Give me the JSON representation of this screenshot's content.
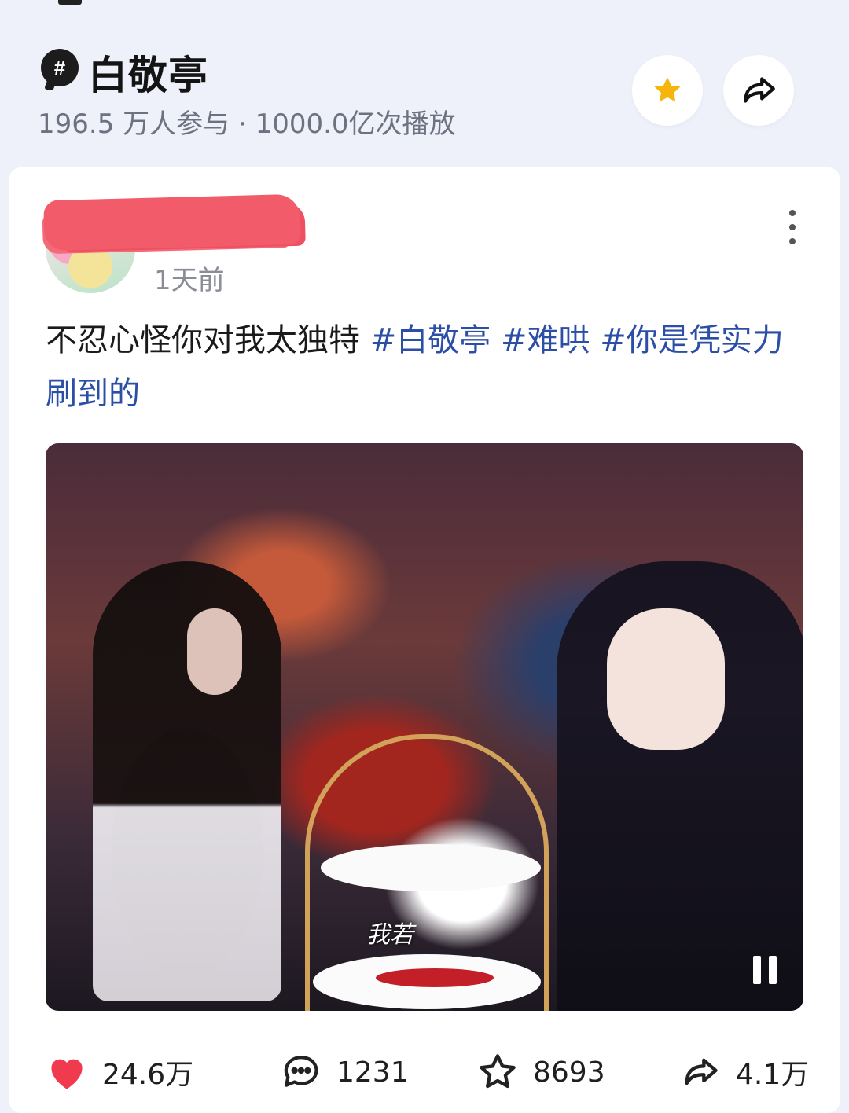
{
  "topic": {
    "hash_symbol": "#",
    "title": "白敬亭",
    "stats": "196.5 万人参与 · 1000.0亿次播放"
  },
  "header_buttons": {
    "favorite_icon": "star-icon",
    "share_icon": "share-arrow-icon"
  },
  "post": {
    "time": "1天前",
    "text": "不忍心怪你对我太独特",
    "tags": [
      "#白敬亭",
      "#难哄",
      "#你是凭实力刷到的"
    ],
    "media": {
      "caption": "我若"
    }
  },
  "actions": {
    "likes": "24.6万",
    "comments": "1231",
    "collects": "8693",
    "shares": "4.1万"
  },
  "colors": {
    "background": "#eef1fa",
    "tag": "#2b4ea6",
    "like": "#f03a4e",
    "star": "#f5b50a"
  }
}
